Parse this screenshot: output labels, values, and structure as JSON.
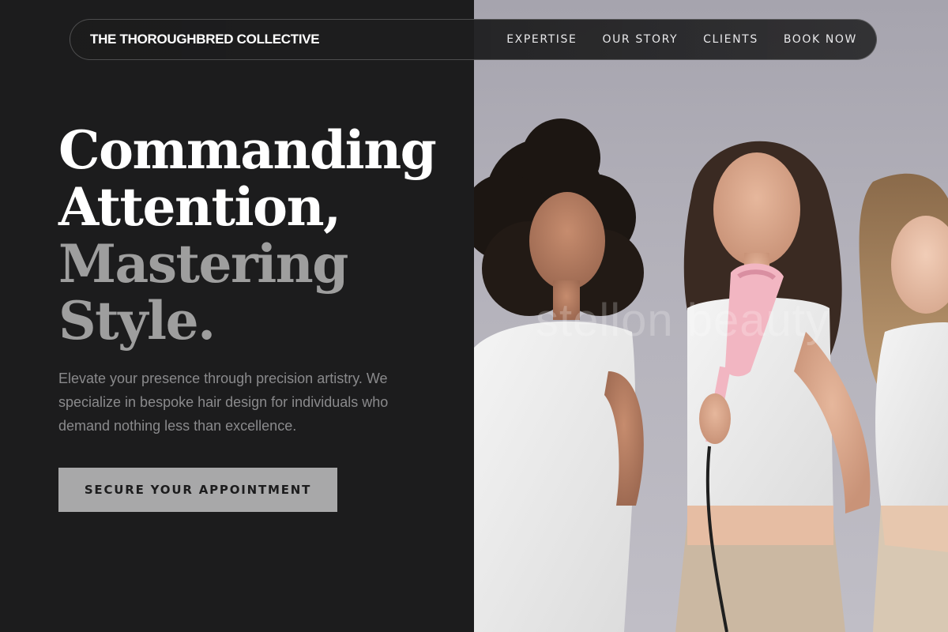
{
  "nav": {
    "brand": "THE THOROUGHBRED COLLECTIVE",
    "links": [
      "EXPERTISE",
      "OUR STORY",
      "CLIENTS",
      "BOOK NOW"
    ]
  },
  "hero": {
    "headline_line1": "Commanding",
    "headline_line2": "Attention,",
    "headline_line3": "Mastering",
    "headline_line4": "Style.",
    "lead": "Elevate your presence through precision artistry. We specialize in bespoke hair design for individuals who demand nothing less than excellence.",
    "cta_label": "SECURE YOUR APPOINTMENT"
  },
  "photo": {
    "watermark": "stellon beauty",
    "description_icon": "model-photo"
  },
  "colors": {
    "background": "#1c1c1d",
    "accent_grey": "#9e9e9e",
    "cta_bg": "#a8a8a9",
    "text_muted": "#8a8a8c"
  }
}
